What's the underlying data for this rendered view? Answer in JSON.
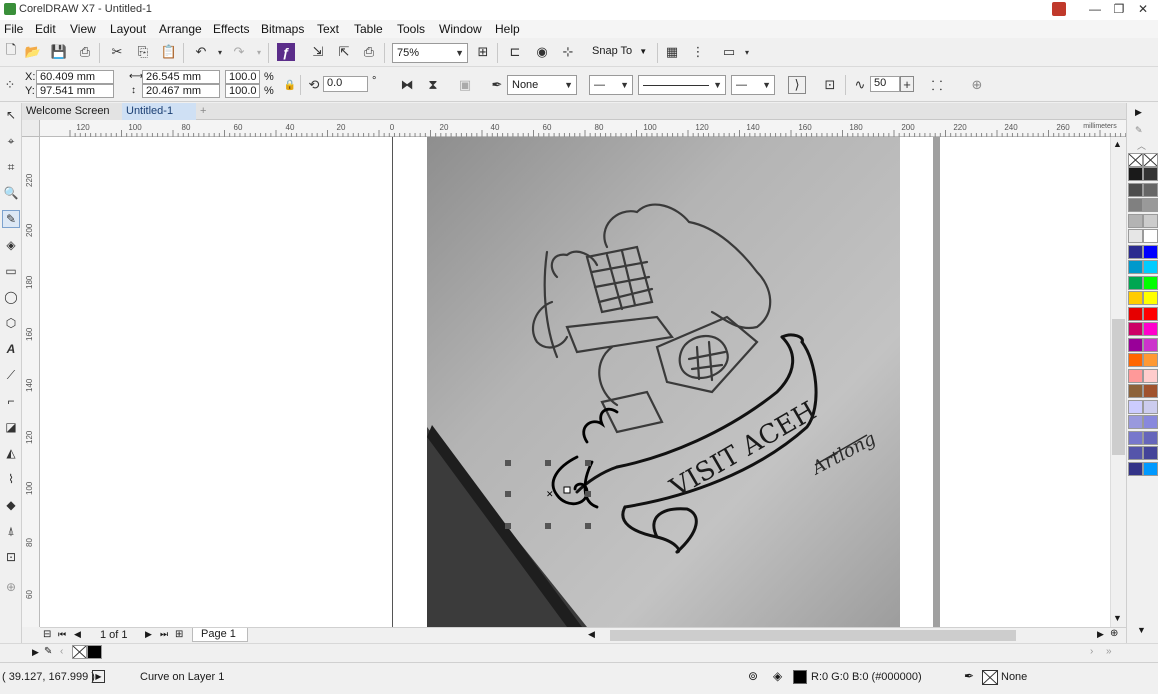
{
  "window": {
    "title": "CorelDRAW X7 - Untitled-1"
  },
  "menu": [
    "File",
    "Edit",
    "View",
    "Layout",
    "Arrange",
    "Effects",
    "Bitmaps",
    "Text",
    "Table",
    "Tools",
    "Window",
    "Help"
  ],
  "toolbar": {
    "zoom": "75%",
    "snap_to": "Snap To"
  },
  "property_bar": {
    "x_label": "X:",
    "x_value": "60.409 mm",
    "y_label": "Y:",
    "y_value": "97.541 mm",
    "width_value": "26.545 mm",
    "height_value": "20.467 mm",
    "scale_x": "100.0",
    "scale_y": "100.0",
    "percent": "%",
    "angle": "0.0",
    "degree": "°",
    "outline_width": "None",
    "smoothing": "50"
  },
  "tabs": {
    "welcome": "Welcome Screen",
    "document": "Untitled-1",
    "add": "+"
  },
  "ruler": {
    "h_ticks": [
      "120",
      "100",
      "80",
      "60",
      "40",
      "20",
      "0",
      "20",
      "40",
      "60",
      "80",
      "100",
      "120",
      "140",
      "160",
      "180",
      "200",
      "220",
      "240",
      "260"
    ],
    "unit": "millimeters",
    "v_ticks": [
      "220",
      "200",
      "180",
      "160",
      "140",
      "120",
      "100",
      "80",
      "60"
    ]
  },
  "artwork": {
    "banner_text": "VISIT ACEH",
    "signature": "Artlong"
  },
  "navigator": {
    "page_count": "1 of 1",
    "page_tab": "Page 1"
  },
  "status": {
    "coords": "( 39.127, 167.999 )",
    "object_info": "Curve on Layer 1",
    "fill_info": "R:0 G:0 B:0 (#000000)",
    "outline_info": "None"
  },
  "palette_colors": [
    "#1a1a1a",
    "#333333",
    "#4d4d4d",
    "#666666",
    "#808080",
    "#999999",
    "#b3b3b3",
    "#cccccc",
    "#e6e6e6",
    "#ffffff",
    "#2b2b8f",
    "#0000ff",
    "#0099cc",
    "#00ccff",
    "#00a651",
    "#00ff00",
    "#ffcc00",
    "#ffff00",
    "#e60000",
    "#ff0000",
    "#cc0066",
    "#ff00cc",
    "#990099",
    "#cc33cc",
    "#ff6600",
    "#ff9933",
    "#ff9999",
    "#ffcccc",
    "#8c6239",
    "#a0522d",
    "#ccccff",
    "#ccccee",
    "#9999dd",
    "#8888dd",
    "#7777cc",
    "#6666bb",
    "#5555aa",
    "#444499",
    "#333388",
    "#0099ff"
  ],
  "colors": {
    "accent": "#3a5fa8",
    "canvas_bg": "#ffffff",
    "selected_fill": "#000000"
  }
}
